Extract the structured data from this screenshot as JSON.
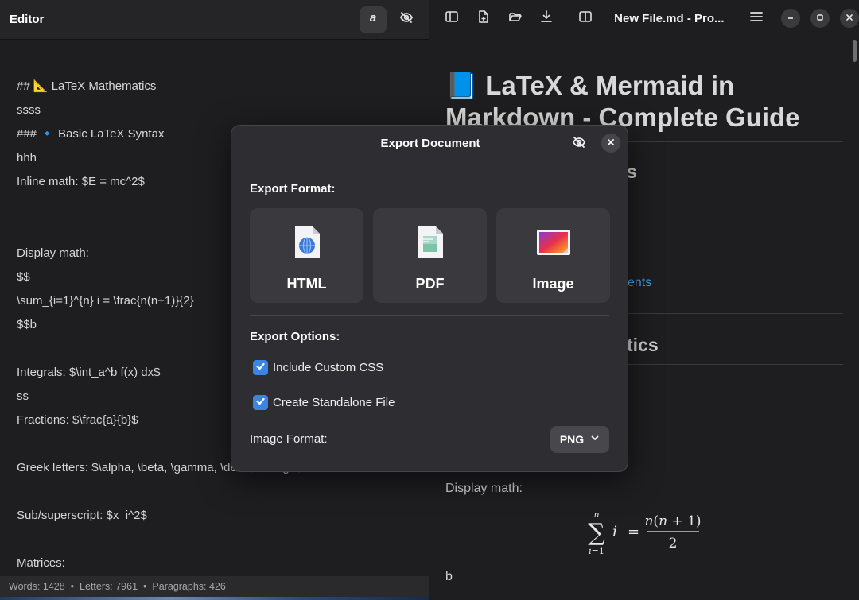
{
  "editor": {
    "title": "Editor",
    "lines": [
      "## 📐 LaTeX Mathematics",
      "ssss",
      "### 🔹 Basic LaTeX Syntax",
      "hhh",
      "Inline math: $E = mc^2$",
      "",
      "",
      "Display math:",
      "$$",
      "\\sum_{i=1}^{n} i = \\frac{n(n+1)}{2}",
      "$$b",
      "",
      "Integrals: $\\int_a^b f(x) dx$",
      "ss",
      "Fractions: $\\frac{a}{b}$",
      "",
      "Greek letters: $\\alpha, \\beta, \\gamma, \\delta, \\omega$",
      "",
      "Sub/superscript: $x_i^2$",
      "",
      "Matrices:"
    ],
    "status": {
      "words": "Words: 1428",
      "letters": "Letters: 7961",
      "paragraphs": "Paragraphs: 426",
      "sep": "•"
    }
  },
  "window": {
    "title": "New File.md - Pro..."
  },
  "preview": {
    "h1_line1": "📘 LaTeX & Mermaid in",
    "h1_line2": "Markdown - Complete Guide",
    "frag_s": "s",
    "frag_ents": "ents",
    "frag_tics": "tics",
    "display_math_label": "Display math:",
    "b_text": "b"
  },
  "modal": {
    "title": "Export Document",
    "export_format_label": "Export Format:",
    "formats": [
      {
        "label": "HTML",
        "icon": "html-file-icon"
      },
      {
        "label": "PDF",
        "icon": "pdf-file-icon"
      },
      {
        "label": "Image",
        "icon": "image-file-icon"
      }
    ],
    "export_options_label": "Export Options:",
    "include_css_label": "Include Custom CSS",
    "include_css_checked": true,
    "standalone_label": "Create Standalone File",
    "standalone_checked": true,
    "image_format_label": "Image Format:",
    "image_format_value": "PNG"
  },
  "colors": {
    "accent": "#3c84e4",
    "link": "#4aa3df",
    "modal_bg": "#2e2e32",
    "card_bg": "#3a3a3e"
  }
}
